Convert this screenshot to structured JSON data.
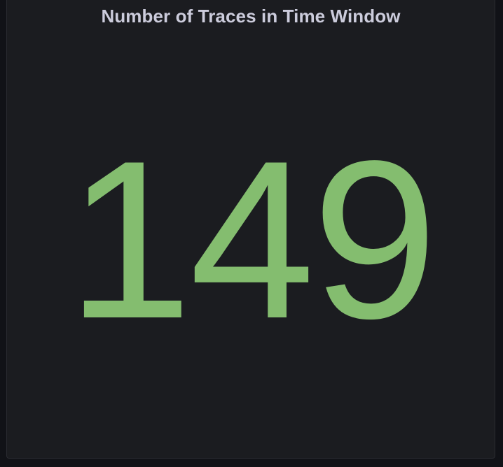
{
  "panel": {
    "title": "Number of Traces in Time Window",
    "value": "149",
    "value_color": "#84bd6f",
    "background": "#1b1c20"
  }
}
